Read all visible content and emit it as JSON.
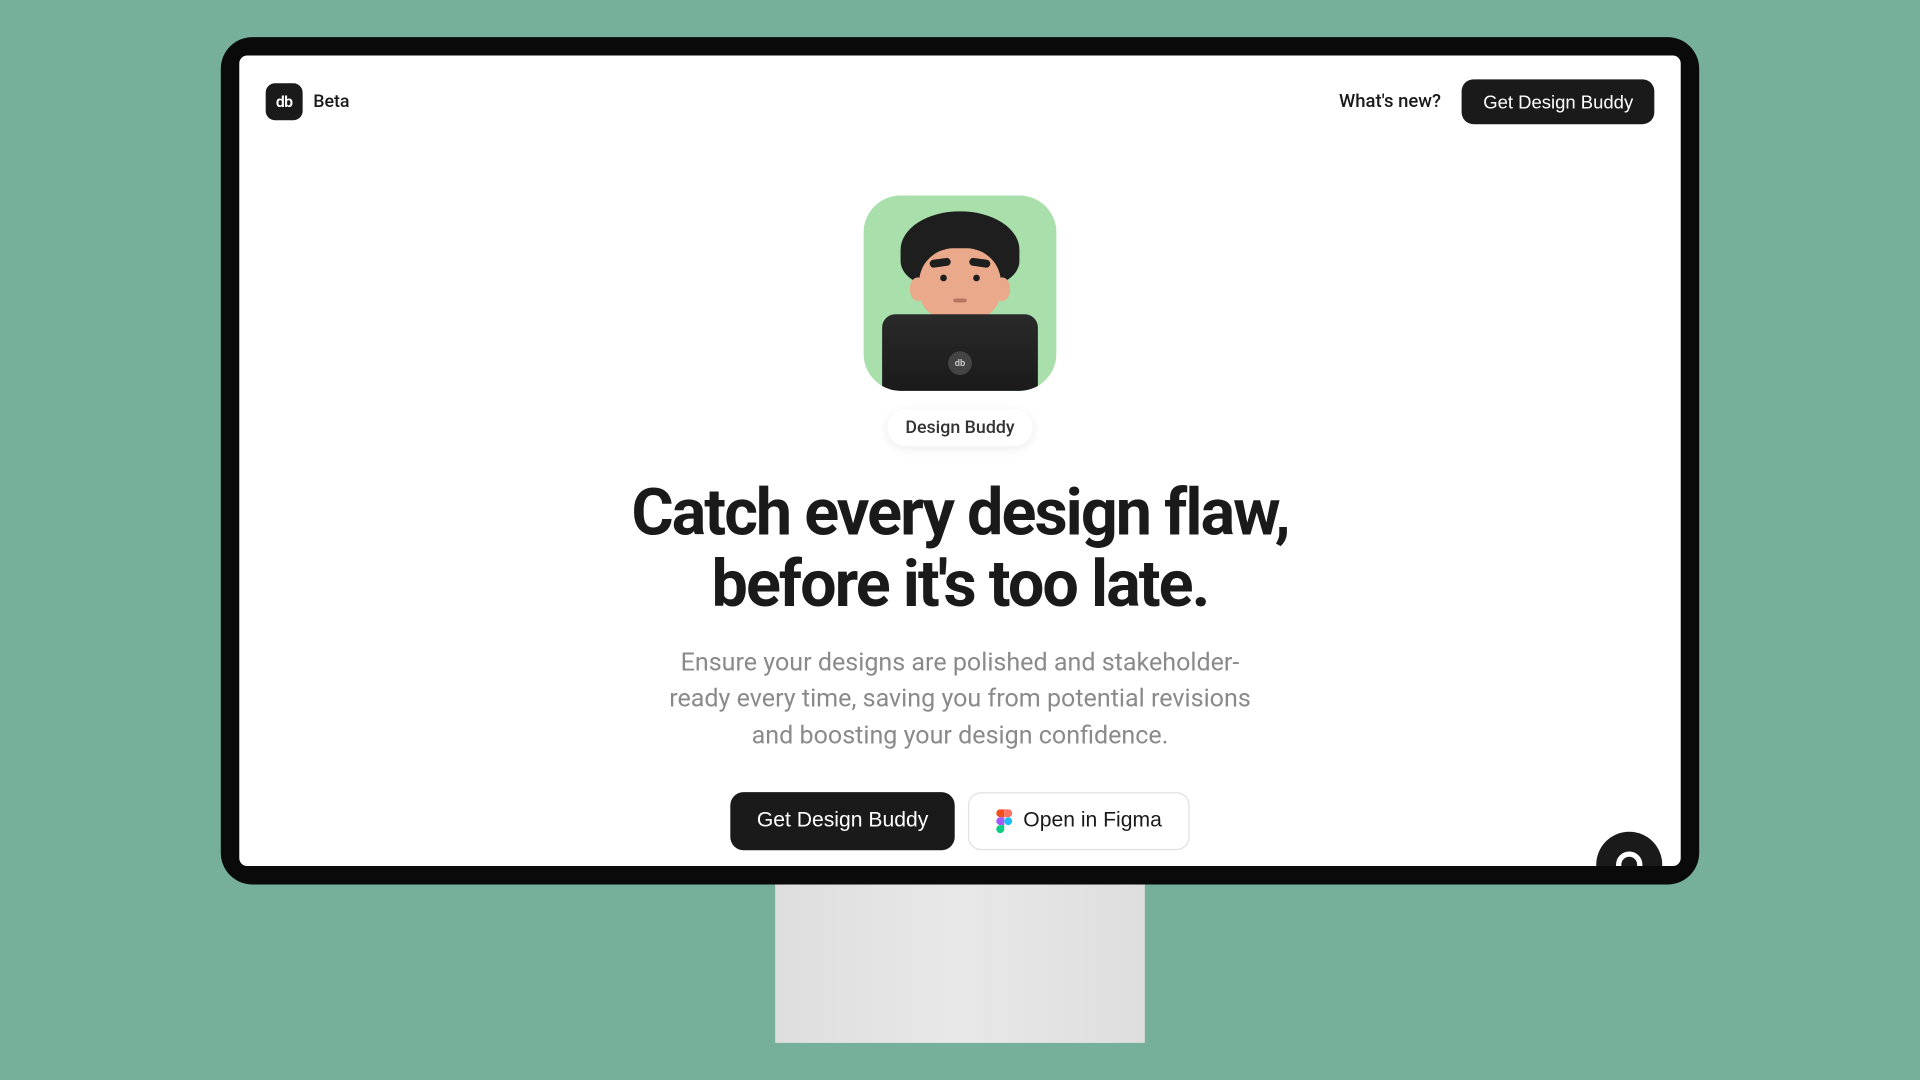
{
  "header": {
    "logo_text": "db",
    "beta_label": "Beta",
    "whats_new_label": "What's new?",
    "cta_label": "Get Design Buddy"
  },
  "hero": {
    "illustration_laptop_logo": "db",
    "name_badge": "Design Buddy",
    "title_line1": "Catch every design flaw,",
    "title_line2": "before it's too late.",
    "subtitle": "Ensure your designs are polished and stakeholder-ready every time, saving you from potential revisions and boosting your design confidence.",
    "primary_cta": "Get Design Buddy",
    "secondary_cta": "Open in Figma"
  }
}
